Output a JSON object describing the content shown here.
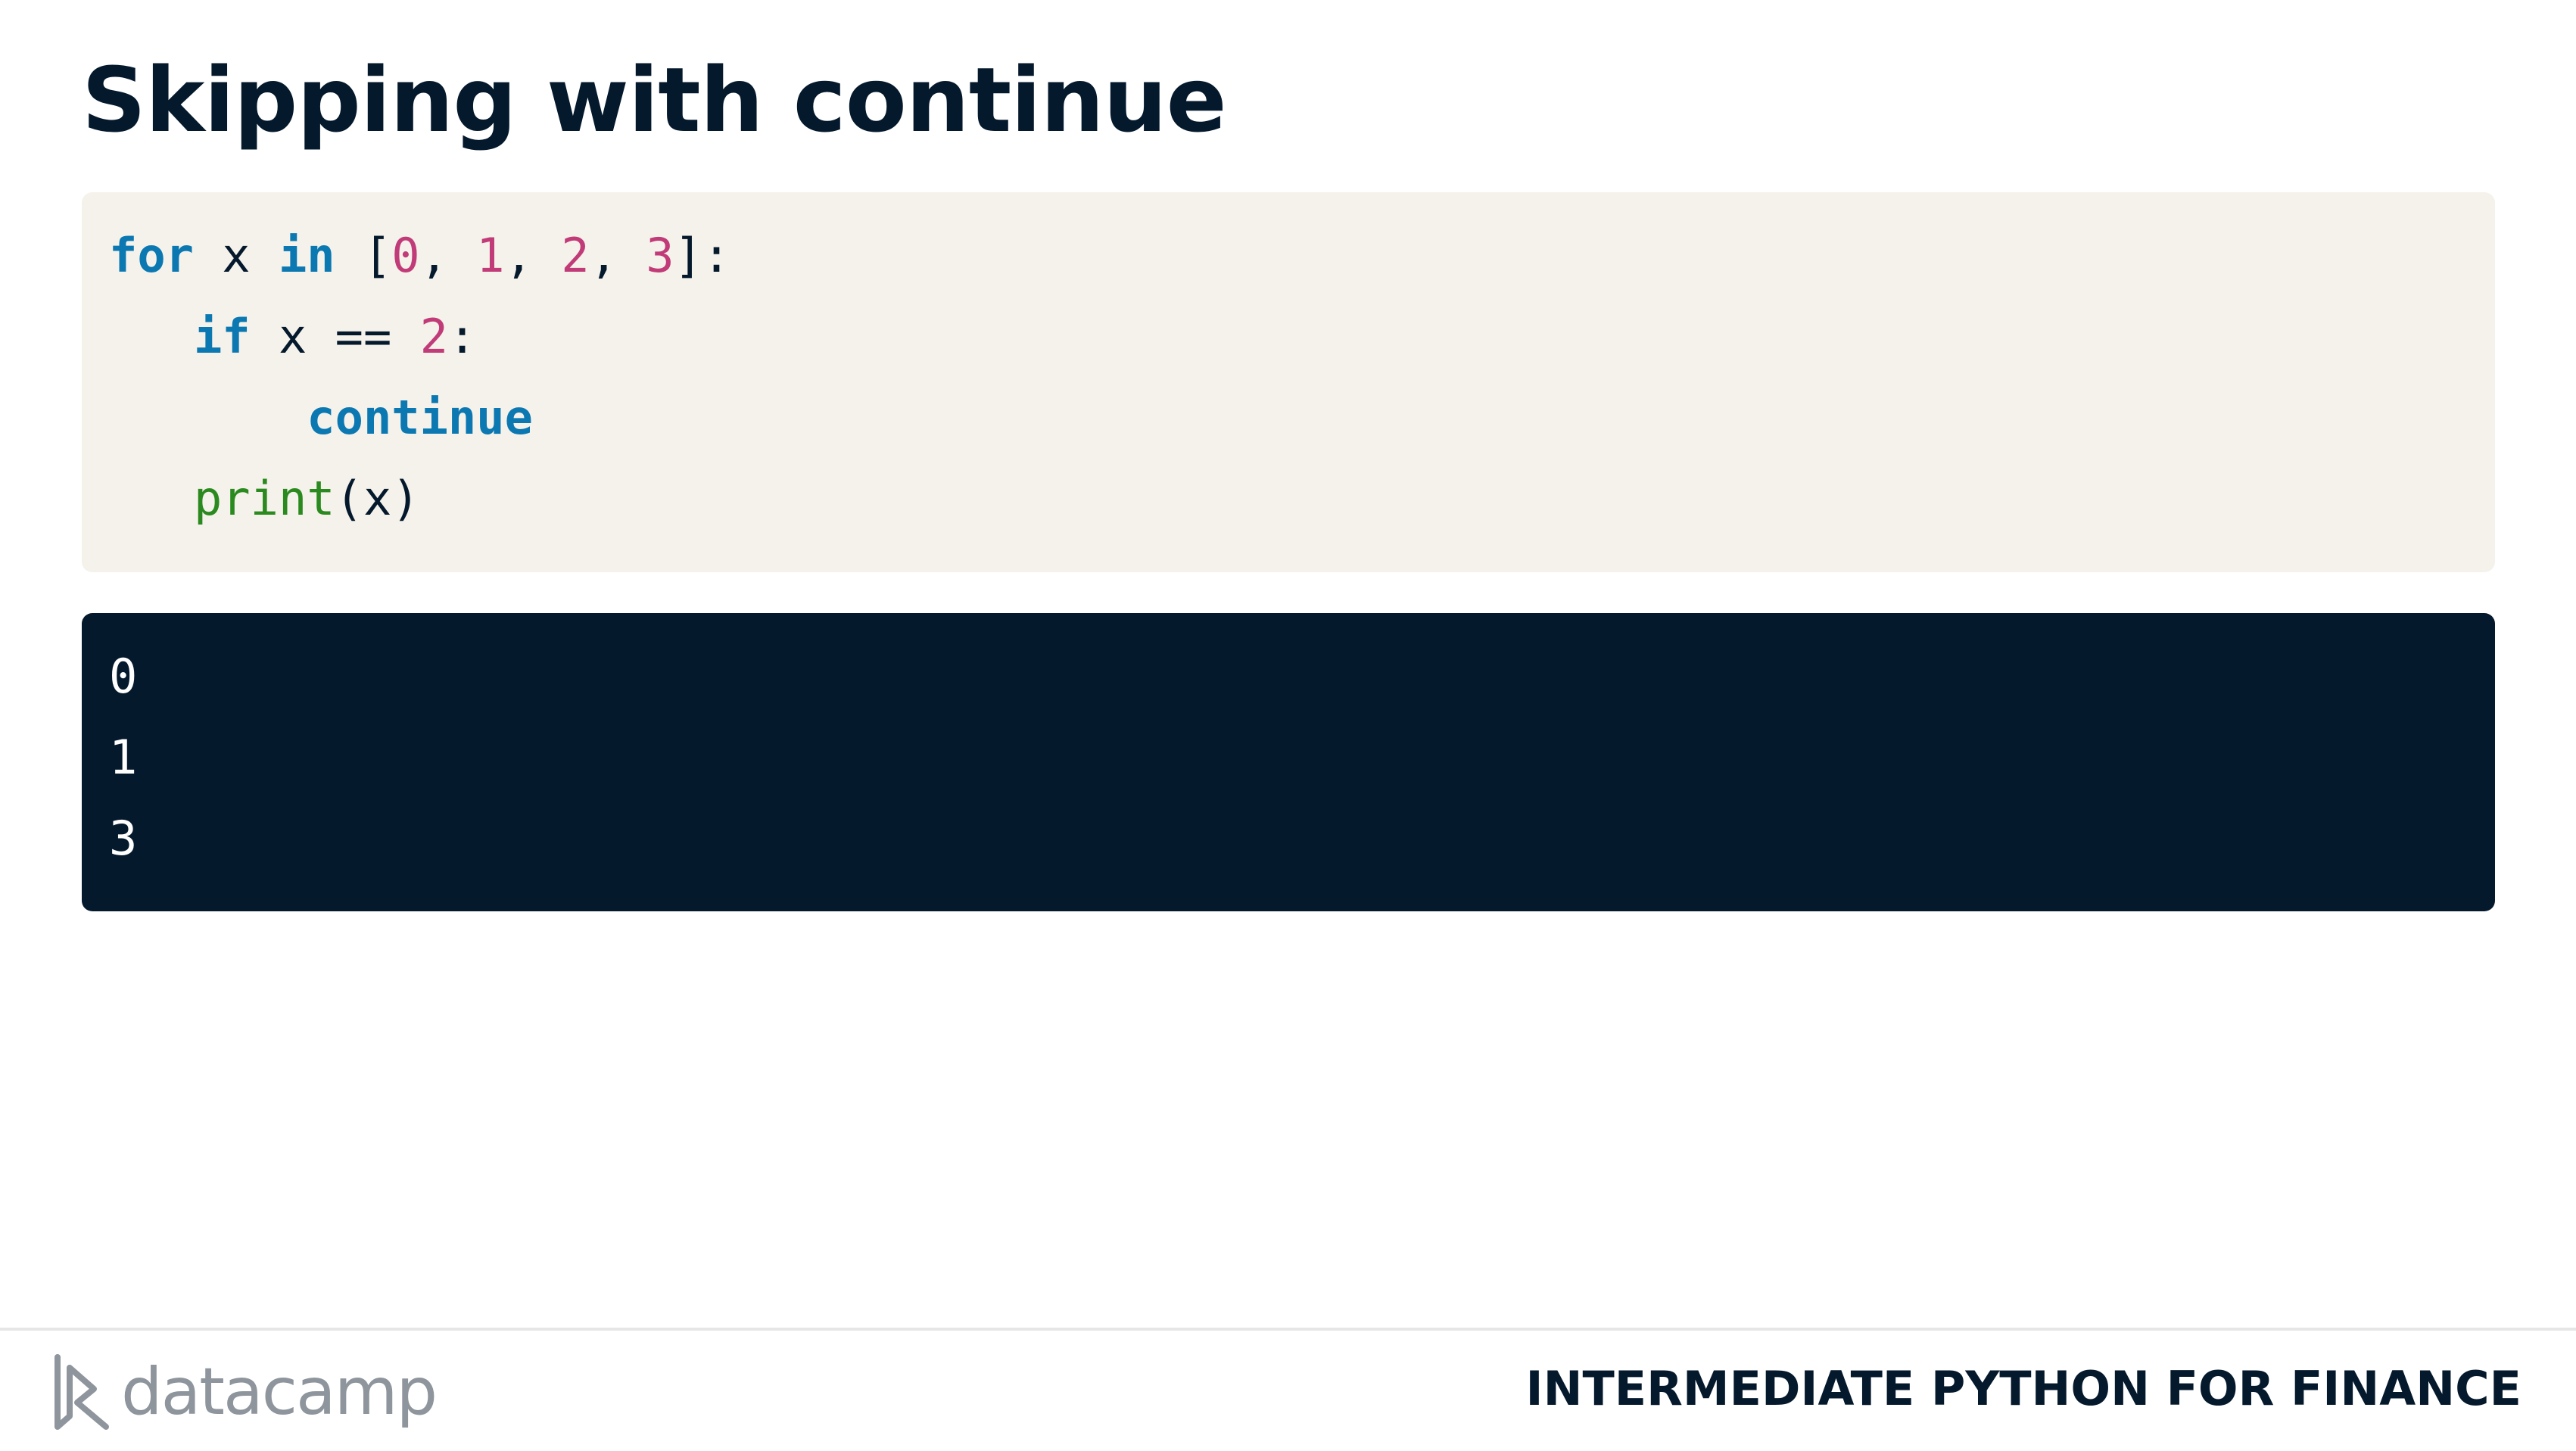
{
  "slide": {
    "title": "Skipping with continue"
  },
  "code": {
    "line1": {
      "kw_for": "for",
      "var": " x ",
      "kw_in": "in",
      "open": " [",
      "n0": "0",
      "sep1": ", ",
      "n1": "1",
      "sep2": ", ",
      "n2": "2",
      "sep3": ", ",
      "n3": "3",
      "close": "]:"
    },
    "line2": {
      "indent": "   ",
      "kw_if": "if",
      "cond": " x == ",
      "n": "2",
      "colon": ":"
    },
    "line3": {
      "indent": "       ",
      "kw_continue": "continue"
    },
    "line4": {
      "indent": "   ",
      "fn_print": "print",
      "args": "(x)"
    }
  },
  "output": {
    "lines": [
      "0",
      "1",
      "3"
    ]
  },
  "footer": {
    "brand": "datacamp",
    "course": "INTERMEDIATE PYTHON FOR FINANCE"
  },
  "colors": {
    "navy": "#05192d",
    "code_bg": "#f5f2eb",
    "keyword": "#0b78b2",
    "number": "#c13b78",
    "function": "#2b8a1f",
    "logo_gray": "#8e959c"
  }
}
